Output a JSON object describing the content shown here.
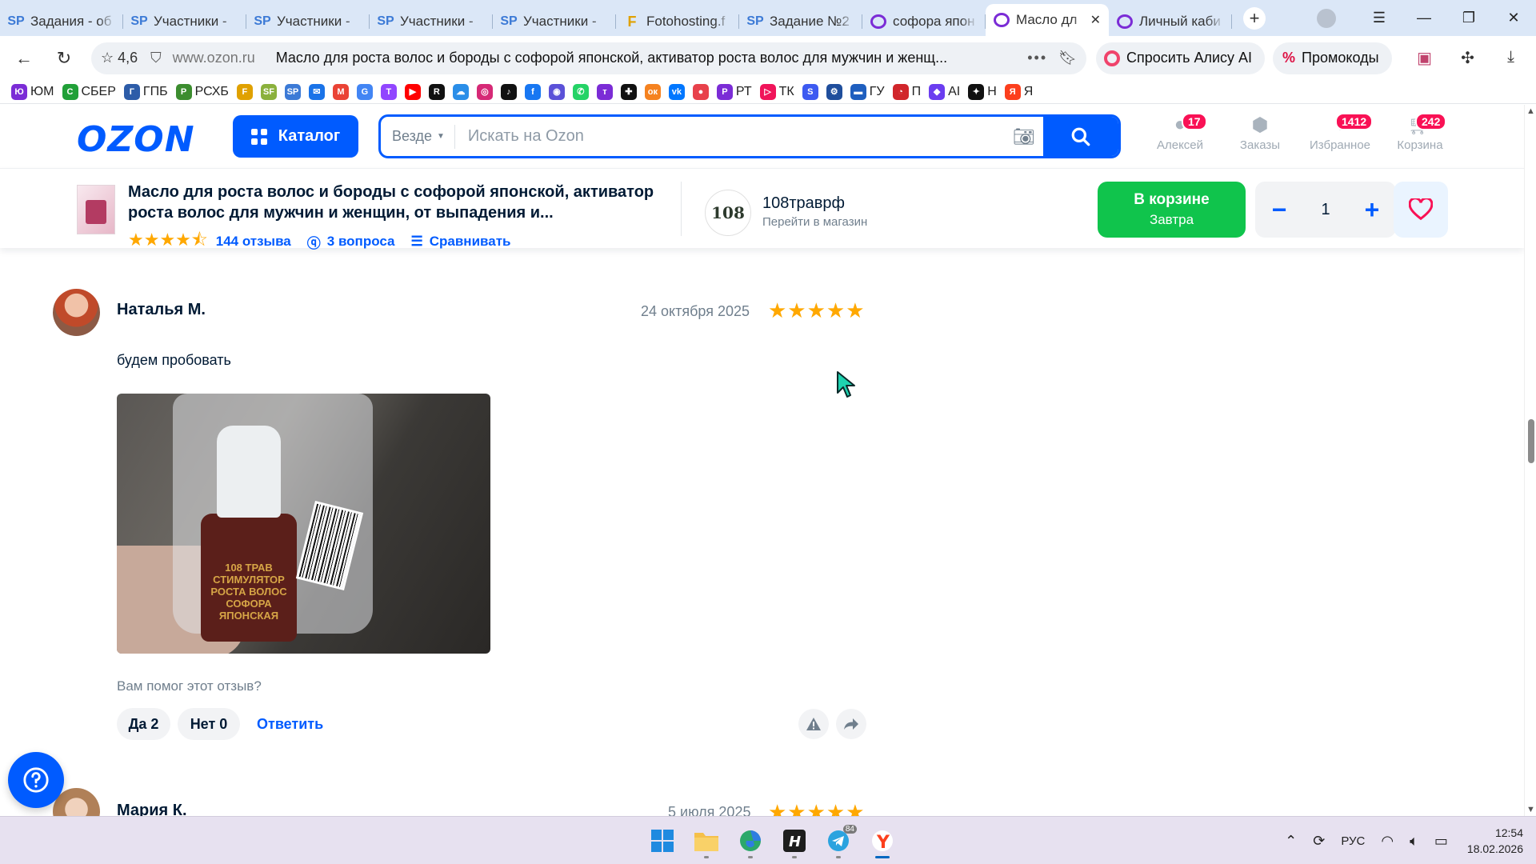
{
  "browser": {
    "tabs": [
      {
        "icon": "sp",
        "label": "Задания - об"
      },
      {
        "icon": "sp",
        "label": "Участники - "
      },
      {
        "icon": "sp",
        "label": "Участники - "
      },
      {
        "icon": "sp",
        "label": "Участники - "
      },
      {
        "icon": "sp",
        "label": "Участники - "
      },
      {
        "icon": "fh",
        "label": "Fotohosting.f"
      },
      {
        "icon": "sp",
        "label": "Задание №2"
      },
      {
        "icon": "ozon",
        "label": "софора япон"
      },
      {
        "icon": "ozon",
        "label": "Масло дл"
      },
      {
        "icon": "ozon",
        "label": "Личный каби"
      }
    ],
    "active_tab_index": 8,
    "address": {
      "rating": "4,6",
      "domain": "www.ozon.ru",
      "page_title": "Масло для роста волос и бороды с софорой японской, активатор роста волос для мужчин и женщ..."
    },
    "alisa_label": "Спросить Алису AI",
    "promo_label": "Промокоды",
    "bookmarks": [
      {
        "label": "ЮМ",
        "color": "#7b2cd6",
        "glyph": "Ю"
      },
      {
        "label": "СБЕР",
        "color": "#21a038",
        "glyph": "С"
      },
      {
        "label": "ГПБ",
        "color": "#2d5ca8",
        "glyph": "Г"
      },
      {
        "label": "РСХБ",
        "color": "#3c8d2f",
        "glyph": "Р"
      },
      {
        "label": "",
        "color": "#e0a100",
        "glyph": "F"
      },
      {
        "label": "",
        "color": "#8bb13c",
        "glyph": "SF"
      },
      {
        "label": "",
        "color": "#3c7ad6",
        "glyph": "SP"
      },
      {
        "label": "",
        "color": "#1a73e8",
        "glyph": "✉"
      },
      {
        "label": "",
        "color": "#ea4335",
        "glyph": "M"
      },
      {
        "label": "",
        "color": "#4285f4",
        "glyph": "G"
      },
      {
        "label": "",
        "color": "#9146ff",
        "glyph": "T"
      },
      {
        "label": "",
        "color": "#ff0000",
        "glyph": "▶"
      },
      {
        "label": "",
        "color": "#111111",
        "glyph": "R"
      },
      {
        "label": "",
        "color": "#2a8ee8",
        "glyph": "☁"
      },
      {
        "label": "",
        "color": "#d62976",
        "glyph": "◎"
      },
      {
        "label": "",
        "color": "#111111",
        "glyph": "♪"
      },
      {
        "label": "",
        "color": "#1877f2",
        "glyph": "f"
      },
      {
        "label": "",
        "color": "#5b51d8",
        "glyph": "◉"
      },
      {
        "label": "",
        "color": "#25d366",
        "glyph": "✆"
      },
      {
        "label": "",
        "color": "#7b2cd6",
        "glyph": "т"
      },
      {
        "label": "",
        "color": "#111111",
        "glyph": "✚"
      },
      {
        "label": "",
        "color": "#f58220",
        "glyph": "ок"
      },
      {
        "label": "",
        "color": "#0077ff",
        "glyph": "vk"
      },
      {
        "label": "",
        "color": "#e8414b",
        "glyph": "●"
      },
      {
        "label": "РТ",
        "color": "#7b2cd6",
        "glyph": "Р"
      },
      {
        "label": "ТК",
        "color": "#f0145a",
        "glyph": "▷"
      },
      {
        "label": "",
        "color": "#3d5af1",
        "glyph": "S"
      },
      {
        "label": "",
        "color": "#1f4e9c",
        "glyph": "⚙"
      },
      {
        "label": "ГУ",
        "color": "#1f5fbf",
        "glyph": "▬"
      },
      {
        "label": "П",
        "color": "#d1262b",
        "glyph": "◔"
      },
      {
        "label": "AI",
        "color": "#6b3df0",
        "glyph": "◆"
      },
      {
        "label": "Н",
        "color": "#111111",
        "glyph": "✦"
      },
      {
        "label": "Я",
        "color": "#fc3f1d",
        "glyph": "Я"
      }
    ]
  },
  "ozon": {
    "logo": "OZON",
    "catalog_label": "Каталог",
    "search_scope": "Везде",
    "search_placeholder": "Искать на Ozon",
    "header_icons": [
      {
        "icon": "user-icon",
        "label": "Алексей",
        "badge": "17"
      },
      {
        "icon": "orders-icon",
        "label": "Заказы",
        "badge": ""
      },
      {
        "icon": "heart-icon",
        "label": "Избранное",
        "badge": "1412"
      },
      {
        "icon": "cart-icon",
        "label": "Корзина",
        "badge": "242"
      }
    ]
  },
  "product": {
    "title": "Масло для роста волос и бороды с софорой японской, активатор роста волос для мужчин и женщин, от выпадения и...",
    "rating_stars": "★★★★⯪",
    "reviews_link": "144 отзыва",
    "questions_link": "3 вопроса",
    "compare_link": "Сравнивать",
    "seller_logo_text": "108",
    "seller_name": "108траврф",
    "seller_link": "Перейти в магазин",
    "cart_button": {
      "line1": "В корзине",
      "line2": "Завтра"
    },
    "quantity": "1",
    "qty_minus": "−",
    "qty_plus": "+"
  },
  "review": {
    "author": "Наталья М.",
    "date": "24 октября 2025",
    "stars": "★★★★★",
    "rating": 5,
    "text": "будем пробовать",
    "photo_label": "108 ТРАВ СТИМУЛЯТОР РОСТА ВОЛОС СОФОРА ЯПОНСКАЯ",
    "helpful_question": "Вам помог этот отзыв?",
    "yes_label": "Да 2",
    "no_label": "Нет 0",
    "reply_label": "Ответить"
  },
  "next_review": {
    "author": "Мария К.",
    "date": "5 июля 2025",
    "stars": "★★★★★",
    "rating": 5
  },
  "taskbar": {
    "language": "РУС",
    "time": "12:54",
    "date": "18.02.2026",
    "telegram_badge": "84"
  }
}
